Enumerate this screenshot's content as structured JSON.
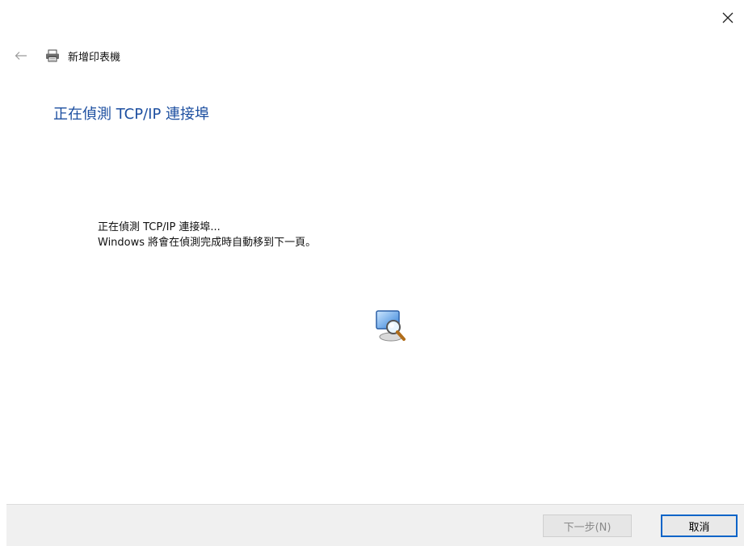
{
  "window": {
    "title": "新增印表機",
    "close_icon": "close-icon",
    "back_icon": "back-arrow-icon",
    "printer_icon": "printer-icon"
  },
  "main": {
    "heading": "正在偵測 TCP/IP 連接埠",
    "message_line1": "正在偵測 TCP/IP 連接埠...",
    "message_line2": "Windows 將會在偵測完成時自動移到下一頁。",
    "status_icon": "detect-magnifier-icon"
  },
  "footer": {
    "next_label": "下一步(N)",
    "next_enabled": false,
    "cancel_label": "取消"
  },
  "colors": {
    "heading": "#1d4fa0",
    "focus_border": "#0a64c8",
    "footer_bg": "#f0f0f0"
  }
}
